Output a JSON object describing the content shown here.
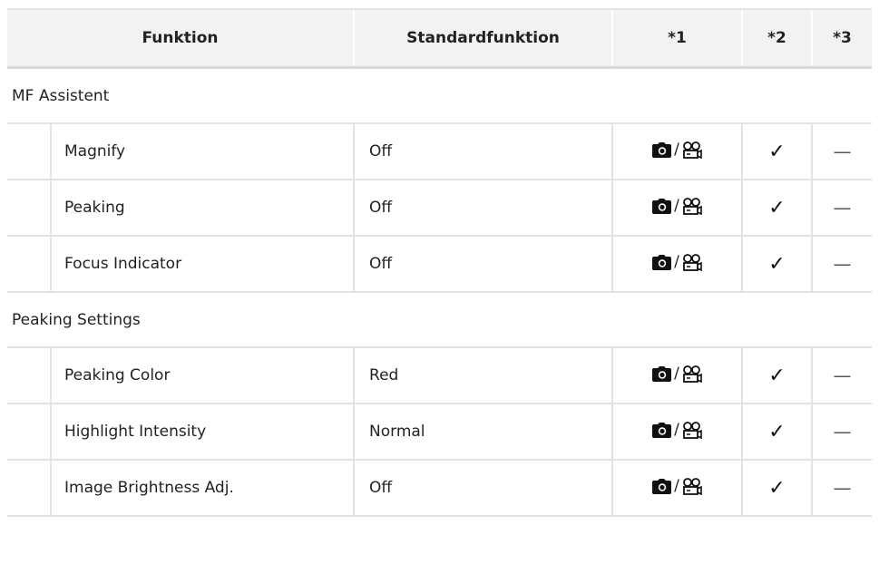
{
  "table": {
    "headers": [
      "Funktion",
      "Standardfunktion",
      "*1",
      "*2",
      "*3"
    ],
    "sections": [
      {
        "title": "MF Assistent",
        "rows": [
          {
            "function": "Magnify",
            "default": "Off",
            "mode_slash": "/",
            "check": "✓",
            "dash": "—"
          },
          {
            "function": "Peaking",
            "default": "Off",
            "mode_slash": "/",
            "check": "✓",
            "dash": "—"
          },
          {
            "function": "Focus Indicator",
            "default": "Off",
            "mode_slash": "/",
            "check": "✓",
            "dash": "—"
          }
        ]
      },
      {
        "title": "Peaking Settings",
        "rows": [
          {
            "function": "Peaking Color",
            "default": "Red",
            "mode_slash": "/",
            "check": "✓",
            "dash": "—"
          },
          {
            "function": "Highlight Intensity",
            "default": "Normal",
            "mode_slash": "/",
            "check": "✓",
            "dash": "—"
          },
          {
            "function": "Image Brightness Adj.",
            "default": "Off",
            "mode_slash": "/",
            "check": "✓",
            "dash": "—"
          }
        ]
      }
    ],
    "icons": {
      "photo": "camera-icon",
      "movie": "movie-camera-icon"
    }
  }
}
